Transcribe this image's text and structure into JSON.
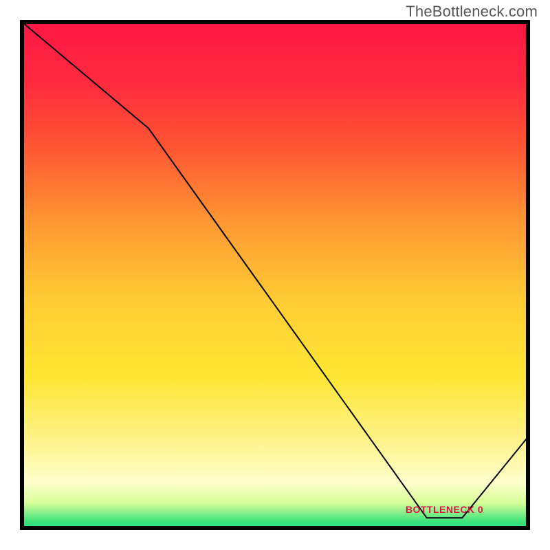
{
  "watermark": "TheBottleneck.com",
  "chart_data": {
    "type": "line",
    "title": "",
    "xlabel": "",
    "ylabel": "",
    "xlim": [
      0,
      100
    ],
    "ylim": [
      0,
      100
    ],
    "grid": false,
    "background_gradient": {
      "stops": [
        {
          "offset": 0.0,
          "color": "#ff1744"
        },
        {
          "offset": 0.12,
          "color": "#ff2a3f"
        },
        {
          "offset": 0.25,
          "color": "#ff5733"
        },
        {
          "offset": 0.4,
          "color": "#ff9933"
        },
        {
          "offset": 0.55,
          "color": "#ffcc33"
        },
        {
          "offset": 0.7,
          "color": "#ffe633"
        },
        {
          "offset": 0.82,
          "color": "#fff285"
        },
        {
          "offset": 0.91,
          "color": "#ffffcc"
        },
        {
          "offset": 0.95,
          "color": "#d8ff99"
        },
        {
          "offset": 0.99,
          "color": "#33e07a"
        }
      ]
    },
    "series": [
      {
        "name": "bottleneck-curve",
        "color": "#000000",
        "stroke_width": 2,
        "x": [
          0,
          25,
          80,
          87,
          100
        ],
        "values": [
          100,
          79,
          2,
          2,
          18
        ]
      }
    ],
    "annotations": [
      {
        "name": "bottleneck-marker",
        "x": 83.5,
        "y": 3,
        "text": "BOTTLENECK 0",
        "color": "#dd1144"
      }
    ]
  }
}
